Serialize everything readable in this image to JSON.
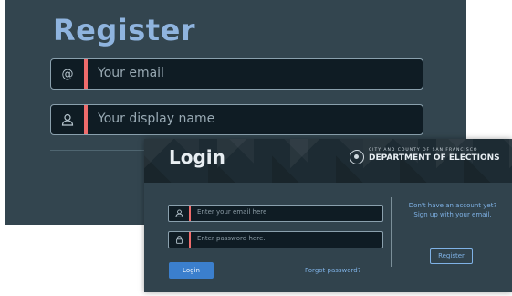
{
  "register": {
    "title": "Register",
    "email_placeholder": "Your email",
    "email_icon": "@",
    "name_placeholder": "Your display name",
    "name_icon": "user-icon"
  },
  "login": {
    "title": "Login",
    "org_small": "CITY AND COUNTY OF SAN FRANCISCO",
    "org_name": "DEPARTMENT OF ELECTIONS",
    "email_placeholder": "Enter your email here",
    "password_placeholder": "Enter password here.",
    "login_button": "Login",
    "forgot_password": "Forgot password?",
    "no_account_line1": "Don't have an account yet?",
    "no_account_line2": "Sign up with your email.",
    "register_button": "Register"
  },
  "colors": {
    "accent": "#ef6c6c",
    "primary_button": "#3b7fcd",
    "link": "#7fb2e6",
    "panel": "#33454f"
  }
}
